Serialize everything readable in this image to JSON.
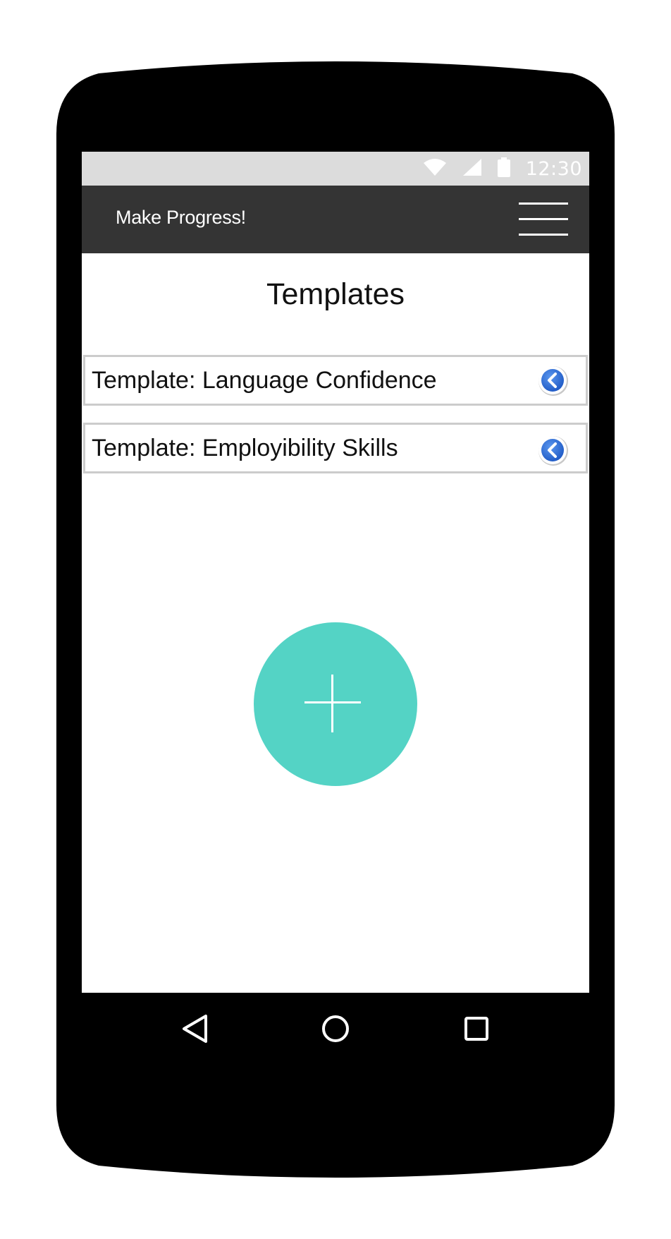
{
  "status_bar": {
    "time": "12:30",
    "icons": [
      "wifi-icon",
      "signal-icon",
      "battery-icon"
    ]
  },
  "app_bar": {
    "title": "Make Progress!",
    "menu_icon": "hamburger-menu-icon"
  },
  "main": {
    "title": "Templates",
    "templates": [
      {
        "label": "Template: Language Confidence",
        "action_icon": "chevron-left-icon"
      },
      {
        "label": "Template: Employibility Skills",
        "action_icon": "chevron-left-icon"
      }
    ],
    "fab_icon": "plus-icon"
  },
  "nav_bar": {
    "buttons": [
      "back-triangle-icon",
      "home-circle-icon",
      "recents-square-icon"
    ]
  },
  "colors": {
    "status_bar": "#dcdcdc",
    "app_bar": "#343434",
    "fab": "#54d3c5",
    "chip_blue": "#2f6fd6",
    "phone_body": "#000000"
  }
}
